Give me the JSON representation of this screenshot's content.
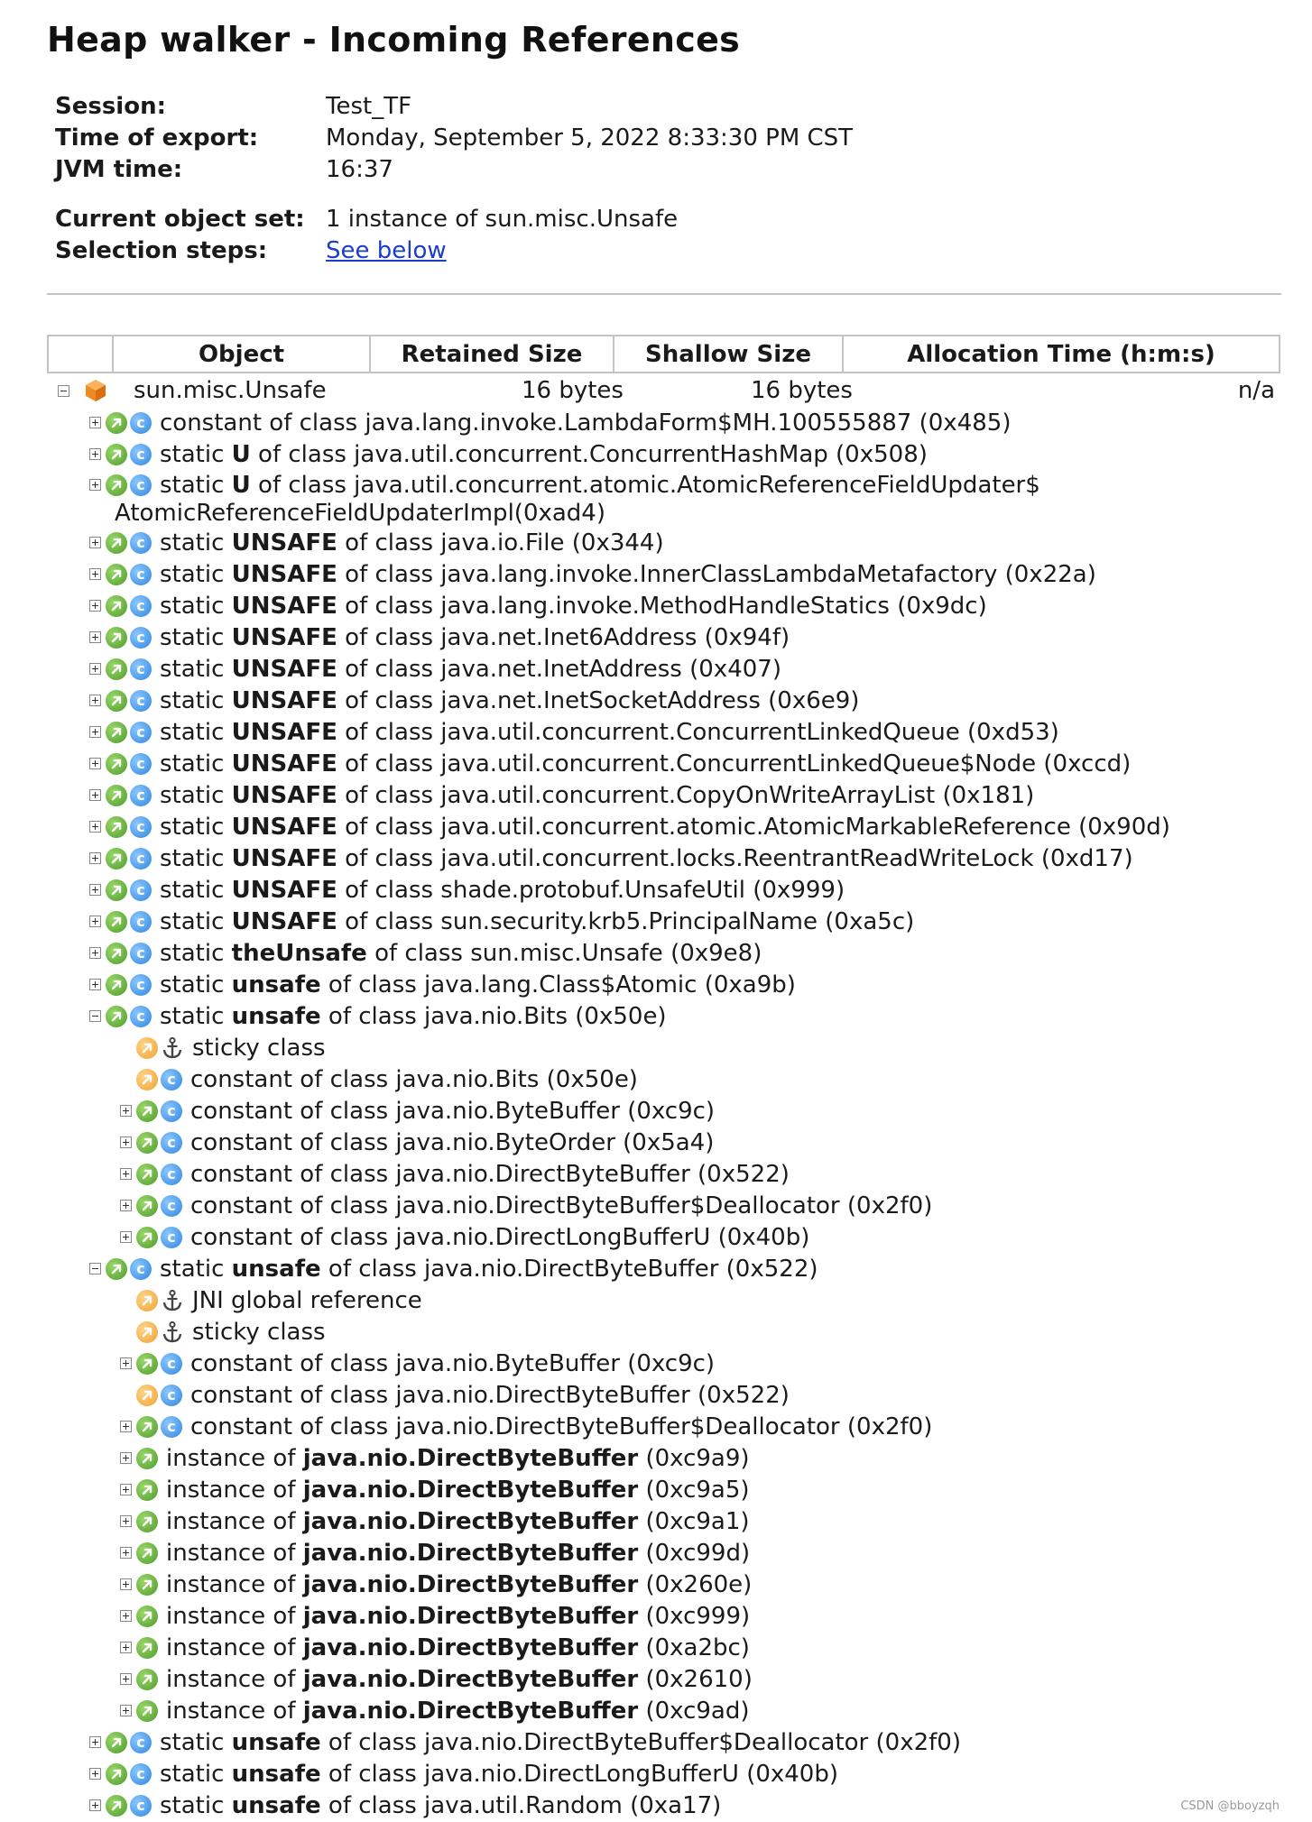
{
  "title": "Heap walker - Incoming References",
  "meta": {
    "session_label": "Session:",
    "session_value": "Test_TF",
    "export_label": "Time of export:",
    "export_value": "Monday, September 5, 2022 8:33:30 PM CST",
    "jvm_label": "JVM time:",
    "jvm_value": "16:37",
    "objset_label": "Current object set:",
    "objset_value": "1 instance of sun.misc.Unsafe",
    "steps_label": "Selection steps:",
    "steps_link": "See below"
  },
  "table": {
    "headers": [
      "Object",
      "Retained Size",
      "Shallow Size",
      "Allocation Time (h:m:s)"
    ],
    "root": {
      "object": "sun.misc.Unsafe",
      "retained": "16 bytes",
      "shallow": "16 bytes",
      "alloc": "n/a"
    }
  },
  "rows": [
    {
      "level": 1,
      "exp": "plus",
      "icon": "green",
      "badge": "class",
      "pre": "constant of class java.lang.invoke.LambdaForm$MH.100555887",
      "field": "",
      "post": "",
      "id": "(0x485)"
    },
    {
      "level": 1,
      "exp": "plus",
      "icon": "green",
      "badge": "class",
      "pre": "static ",
      "field": "U",
      "post": " of class java.util.concurrent.ConcurrentHashMap",
      "id": "(0x508)"
    },
    {
      "level": 1,
      "exp": "plus",
      "icon": "green",
      "badge": "class",
      "pre": "static ",
      "field": "U",
      "post": " of class java.util.concurrent.atomic.AtomicReferenceFieldUpdater$",
      "id": "",
      "wrap": "AtomicReferenceFieldUpdaterImpl",
      "wrap_id": "(0xad4)"
    },
    {
      "level": 1,
      "exp": "plus",
      "icon": "green",
      "badge": "class",
      "pre": "static ",
      "field": "UNSAFE",
      "post": " of class java.io.File",
      "id": "(0x344)"
    },
    {
      "level": 1,
      "exp": "plus",
      "icon": "green",
      "badge": "class",
      "pre": "static ",
      "field": "UNSAFE",
      "post": " of class java.lang.invoke.InnerClassLambdaMetafactory",
      "id": "(0x22a)"
    },
    {
      "level": 1,
      "exp": "plus",
      "icon": "green",
      "badge": "class",
      "pre": "static ",
      "field": "UNSAFE",
      "post": " of class java.lang.invoke.MethodHandleStatics",
      "id": "(0x9dc)"
    },
    {
      "level": 1,
      "exp": "plus",
      "icon": "green",
      "badge": "class",
      "pre": "static ",
      "field": "UNSAFE",
      "post": " of class java.net.Inet6Address",
      "id": "(0x94f)"
    },
    {
      "level": 1,
      "exp": "plus",
      "icon": "green",
      "badge": "class",
      "pre": "static ",
      "field": "UNSAFE",
      "post": " of class java.net.InetAddress",
      "id": "(0x407)"
    },
    {
      "level": 1,
      "exp": "plus",
      "icon": "green",
      "badge": "class",
      "pre": "static ",
      "field": "UNSAFE",
      "post": " of class java.net.InetSocketAddress",
      "id": "(0x6e9)"
    },
    {
      "level": 1,
      "exp": "plus",
      "icon": "green",
      "badge": "class",
      "pre": "static ",
      "field": "UNSAFE",
      "post": " of class java.util.concurrent.ConcurrentLinkedQueue",
      "id": "(0xd53)"
    },
    {
      "level": 1,
      "exp": "plus",
      "icon": "green",
      "badge": "class",
      "pre": "static ",
      "field": "UNSAFE",
      "post": " of class java.util.concurrent.ConcurrentLinkedQueue$Node",
      "id": "(0xccd)"
    },
    {
      "level": 1,
      "exp": "plus",
      "icon": "green",
      "badge": "class",
      "pre": "static ",
      "field": "UNSAFE",
      "post": " of class java.util.concurrent.CopyOnWriteArrayList",
      "id": "(0x181)"
    },
    {
      "level": 1,
      "exp": "plus",
      "icon": "green",
      "badge": "class",
      "pre": "static ",
      "field": "UNSAFE",
      "post": " of class java.util.concurrent.atomic.AtomicMarkableReference",
      "id": "(0x90d)"
    },
    {
      "level": 1,
      "exp": "plus",
      "icon": "green",
      "badge": "class",
      "pre": "static ",
      "field": "UNSAFE",
      "post": " of class java.util.concurrent.locks.ReentrantReadWriteLock",
      "id": "(0xd17)"
    },
    {
      "level": 1,
      "exp": "plus",
      "icon": "green",
      "badge": "class",
      "pre": "static ",
      "field": "UNSAFE",
      "post": " of class shade.protobuf.UnsafeUtil",
      "id": "(0x999)"
    },
    {
      "level": 1,
      "exp": "plus",
      "icon": "green",
      "badge": "class",
      "pre": "static ",
      "field": "UNSAFE",
      "post": " of class sun.security.krb5.PrincipalName",
      "id": "(0xa5c)"
    },
    {
      "level": 1,
      "exp": "plus",
      "icon": "green",
      "badge": "class",
      "pre": "static ",
      "field": "theUnsafe",
      "post": " of class sun.misc.Unsafe",
      "id": "(0x9e8)"
    },
    {
      "level": 1,
      "exp": "plus",
      "icon": "green",
      "badge": "class",
      "pre": "static ",
      "field": "unsafe",
      "post": " of class java.lang.Class$Atomic",
      "id": "(0xa9b)"
    },
    {
      "level": 1,
      "exp": "minus",
      "icon": "green",
      "badge": "class",
      "pre": "static ",
      "field": "unsafe",
      "post": " of class java.nio.Bits",
      "id": "(0x50e)"
    },
    {
      "level": 2,
      "exp": "none",
      "icon": "orange",
      "badge": "anchor",
      "pre": "sticky class",
      "field": "",
      "post": "",
      "id": ""
    },
    {
      "level": 2,
      "exp": "none",
      "icon": "orange",
      "badge": "class",
      "pre": "constant of class java.nio.Bits",
      "field": "",
      "post": "",
      "id": "(0x50e)"
    },
    {
      "level": 2,
      "exp": "plus",
      "icon": "green",
      "badge": "class",
      "pre": "constant of class java.nio.ByteBuffer",
      "field": "",
      "post": "",
      "id": "(0xc9c)"
    },
    {
      "level": 2,
      "exp": "plus",
      "icon": "green",
      "badge": "class",
      "pre": "constant of class java.nio.ByteOrder",
      "field": "",
      "post": "",
      "id": "(0x5a4)"
    },
    {
      "level": 2,
      "exp": "plus",
      "icon": "green",
      "badge": "class",
      "pre": "constant of class java.nio.DirectByteBuffer",
      "field": "",
      "post": "",
      "id": "(0x522)"
    },
    {
      "level": 2,
      "exp": "plus",
      "icon": "green",
      "badge": "class",
      "pre": "constant of class java.nio.DirectByteBuffer$Deallocator",
      "field": "",
      "post": "",
      "id": "(0x2f0)"
    },
    {
      "level": 2,
      "exp": "plus",
      "icon": "green",
      "badge": "class",
      "pre": "constant of class java.nio.DirectLongBufferU",
      "field": "",
      "post": "",
      "id": "(0x40b)"
    },
    {
      "level": 1,
      "exp": "minus",
      "icon": "green",
      "badge": "class",
      "pre": "static ",
      "field": "unsafe",
      "post": " of class java.nio.DirectByteBuffer",
      "id": "(0x522)"
    },
    {
      "level": 2,
      "exp": "none",
      "icon": "orange",
      "badge": "anchor",
      "pre": "JNI global reference",
      "field": "",
      "post": "",
      "id": ""
    },
    {
      "level": 2,
      "exp": "none",
      "icon": "orange",
      "badge": "anchor",
      "pre": "sticky class",
      "field": "",
      "post": "",
      "id": ""
    },
    {
      "level": 2,
      "exp": "plus",
      "icon": "green",
      "badge": "class",
      "pre": "constant of class java.nio.ByteBuffer",
      "field": "",
      "post": "",
      "id": "(0xc9c)"
    },
    {
      "level": 2,
      "exp": "none",
      "icon": "orange",
      "badge": "class",
      "pre": "constant of class java.nio.DirectByteBuffer",
      "field": "",
      "post": "",
      "id": "(0x522)"
    },
    {
      "level": 2,
      "exp": "plus",
      "icon": "green",
      "badge": "class",
      "pre": "constant of class java.nio.DirectByteBuffer$Deallocator",
      "field": "",
      "post": "",
      "id": "(0x2f0)"
    },
    {
      "level": 2,
      "exp": "plus",
      "icon": "green",
      "badge": "none",
      "pre": "instance of ",
      "field": "java.nio.DirectByteBuffer",
      "post": "",
      "id": "(0xc9a9)"
    },
    {
      "level": 2,
      "exp": "plus",
      "icon": "green",
      "badge": "none",
      "pre": "instance of ",
      "field": "java.nio.DirectByteBuffer",
      "post": "",
      "id": "(0xc9a5)"
    },
    {
      "level": 2,
      "exp": "plus",
      "icon": "green",
      "badge": "none",
      "pre": "instance of ",
      "field": "java.nio.DirectByteBuffer",
      "post": "",
      "id": "(0xc9a1)"
    },
    {
      "level": 2,
      "exp": "plus",
      "icon": "green",
      "badge": "none",
      "pre": "instance of ",
      "field": "java.nio.DirectByteBuffer",
      "post": "",
      "id": "(0xc99d)"
    },
    {
      "level": 2,
      "exp": "plus",
      "icon": "green",
      "badge": "none",
      "pre": "instance of ",
      "field": "java.nio.DirectByteBuffer",
      "post": "",
      "id": "(0x260e)"
    },
    {
      "level": 2,
      "exp": "plus",
      "icon": "green",
      "badge": "none",
      "pre": "instance of ",
      "field": "java.nio.DirectByteBuffer",
      "post": "",
      "id": "(0xc999)"
    },
    {
      "level": 2,
      "exp": "plus",
      "icon": "green",
      "badge": "none",
      "pre": "instance of ",
      "field": "java.nio.DirectByteBuffer",
      "post": "",
      "id": "(0xa2bc)"
    },
    {
      "level": 2,
      "exp": "plus",
      "icon": "green",
      "badge": "none",
      "pre": "instance of ",
      "field": "java.nio.DirectByteBuffer",
      "post": "",
      "id": "(0x2610)"
    },
    {
      "level": 2,
      "exp": "plus",
      "icon": "green",
      "badge": "none",
      "pre": "instance of ",
      "field": "java.nio.DirectByteBuffer",
      "post": "",
      "id": "(0xc9ad)"
    },
    {
      "level": 1,
      "exp": "plus",
      "icon": "green",
      "badge": "class",
      "pre": "static ",
      "field": "unsafe",
      "post": " of class java.nio.DirectByteBuffer$Deallocator",
      "id": "(0x2f0)"
    },
    {
      "level": 1,
      "exp": "plus",
      "icon": "green",
      "badge": "class",
      "pre": "static ",
      "field": "unsafe",
      "post": " of class java.nio.DirectLongBufferU",
      "id": "(0x40b)"
    },
    {
      "level": 1,
      "exp": "plus",
      "icon": "green",
      "badge": "class",
      "pre": "static ",
      "field": "unsafe",
      "post": " of class java.util.Random",
      "id": "(0xa17)"
    }
  ],
  "watermark": "CSDN @bboyzqh",
  "colors": {
    "link": "#1a3dcc",
    "green_ref": "#4e9b2a",
    "orange_ref": "#f0a030",
    "class_badge": "#2f86e0",
    "root_cube": "#f08a24"
  }
}
